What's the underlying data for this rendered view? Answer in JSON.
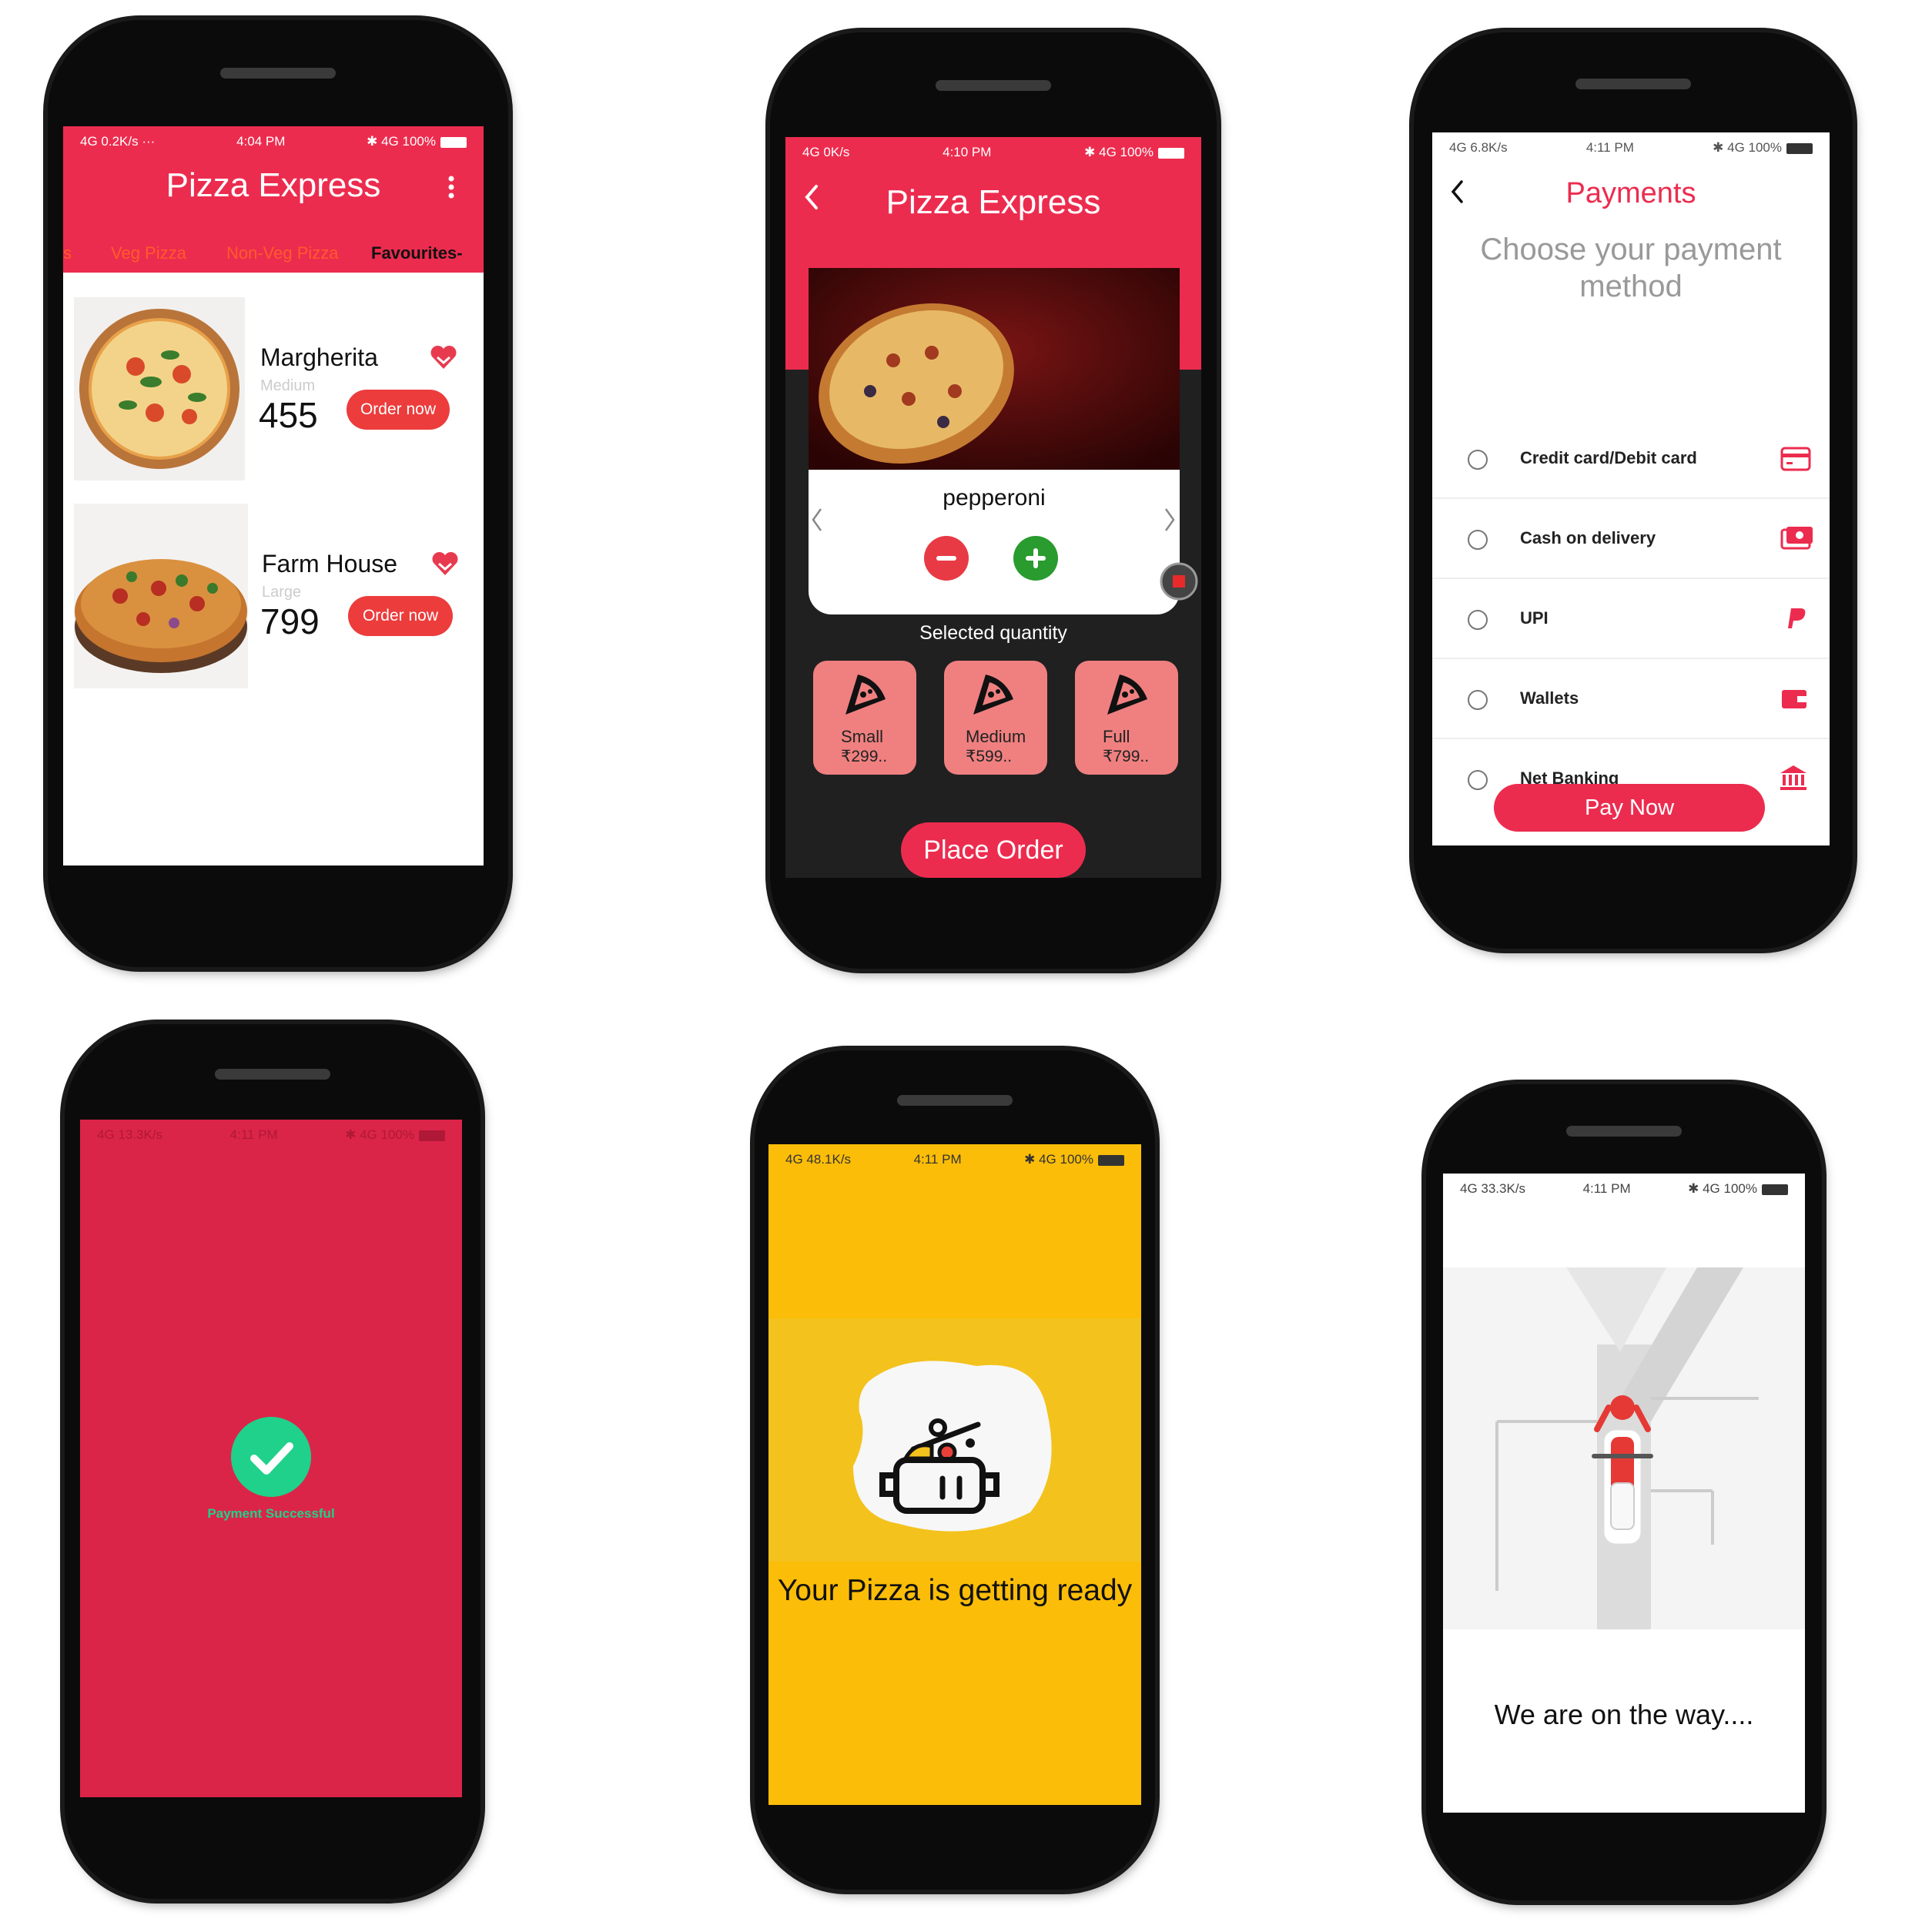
{
  "colors": {
    "brand": "#ec2c4f",
    "dark": "#202020",
    "yellow": "#fbbd08",
    "success": "#1fd18b",
    "order_btn": "#ec3c3c",
    "size_card": "#f08080"
  },
  "screen1": {
    "status": {
      "left": "4G 0.2K/s ···",
      "time": "4:04 PM",
      "right": "✱ 4G 100%"
    },
    "title": "Pizza Express",
    "tabs": [
      "s",
      "Veg Pizza",
      "Non-Veg Pizza",
      "Favourites-"
    ],
    "items": [
      {
        "name": "Margherita",
        "size": "Medium",
        "price": "455",
        "button": "Order now"
      },
      {
        "name": "Farm House",
        "size": "Large",
        "price": "799",
        "button": "Order now"
      }
    ]
  },
  "screen2": {
    "status": {
      "left": "4G 0K/s",
      "time": "4:10 PM",
      "right": "✱ 4G 100%"
    },
    "title": "Pizza Express",
    "pizza_name": "pepperoni",
    "quantity_label": "Selected quantity",
    "sizes": [
      {
        "name": "Small",
        "price": "₹299.."
      },
      {
        "name": "Medium",
        "price": "₹599.."
      },
      {
        "name": "Full",
        "price": "₹799.."
      }
    ],
    "place_order": "Place Order"
  },
  "screen3": {
    "status": {
      "left": "4G 6.8K/s",
      "time": "4:11 PM",
      "right": "✱ 4G 100%"
    },
    "title": "Payments",
    "subtitle": "Choose your payment method",
    "methods": [
      {
        "label": "Credit card/Debit card",
        "icon": "credit-card-icon"
      },
      {
        "label": "Cash on delivery",
        "icon": "cash-icon"
      },
      {
        "label": "UPI",
        "icon": "upi-icon"
      },
      {
        "label": "Wallets",
        "icon": "wallet-icon"
      },
      {
        "label": "Net Banking",
        "icon": "bank-icon"
      }
    ],
    "pay_button": "Pay Now"
  },
  "screen4": {
    "status": {
      "left": "4G 13.3K/s",
      "time": "4:11 PM",
      "right": "✱ 4G 100%"
    },
    "message": "Payment Successful"
  },
  "screen5": {
    "status": {
      "left": "4G 48.1K/s",
      "time": "4:11 PM",
      "right": "✱ 4G 100%"
    },
    "message": "Your Pizza is getting ready"
  },
  "screen6": {
    "status": {
      "left": "4G 33.3K/s",
      "time": "4:11 PM",
      "right": "✱ 4G 100%"
    },
    "message": "We are on the way...."
  }
}
